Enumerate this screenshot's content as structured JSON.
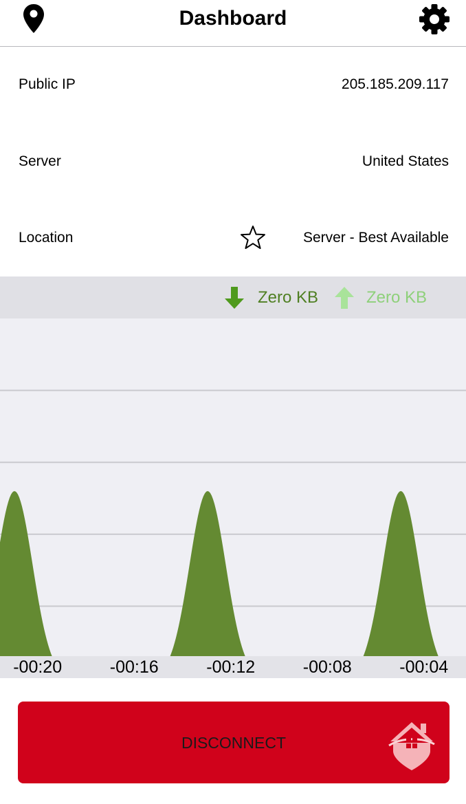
{
  "header": {
    "title": "Dashboard",
    "left_icon": "location-pin-icon",
    "right_icon": "gear-icon"
  },
  "info": {
    "public_ip": {
      "label": "Public IP",
      "value": "205.185.209.117"
    },
    "server": {
      "label": "Server",
      "value": "United States"
    },
    "location": {
      "label": "Location",
      "value": "Server - Best Available",
      "icon": "star-outline-icon"
    }
  },
  "traffic": {
    "download": {
      "icon": "arrow-down-icon",
      "value": "Zero KB",
      "color": "#4f7f22"
    },
    "upload": {
      "icon": "arrow-up-icon",
      "value": "Zero KB",
      "color": "#8ed07a"
    }
  },
  "chart_data": {
    "type": "area",
    "title": "",
    "xlabel": "",
    "ylabel": "",
    "x_tick_labels": [
      "-00:20",
      "-00:16",
      "-00:12",
      "-00:08",
      "-00:04"
    ],
    "x_tick_values": [
      -20,
      -16,
      -12,
      -8,
      -4
    ],
    "xlim": [
      -21.8,
      -2.5
    ],
    "ylim": [
      0,
      5
    ],
    "grid": true,
    "series": [
      {
        "color": "#648a32",
        "peak_times": [
          -21.2,
          -13.2,
          -5.2
        ],
        "peak_value": 2.6
      }
    ]
  },
  "actions": {
    "disconnect_label": "DISCONNECT",
    "disconnect_color": "#d0021b",
    "disconnect_icon": "house-shield-icon"
  }
}
